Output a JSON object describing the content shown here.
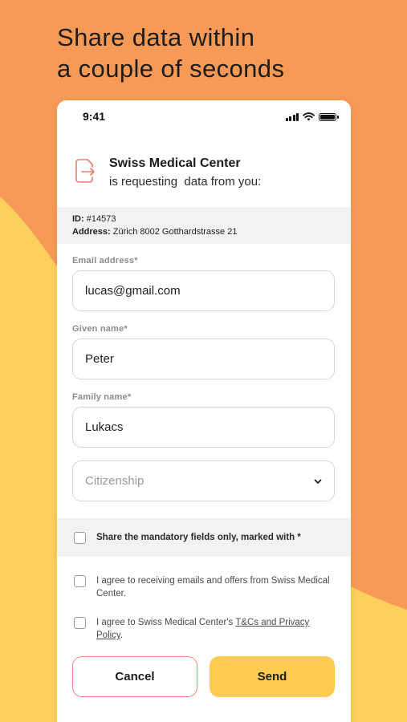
{
  "headline": {
    "line1": "Share data within",
    "line2": "a couple of seconds"
  },
  "colors": {
    "background_orange": "#F79A57",
    "background_yellow": "#FDCF5B",
    "accent_red": "#F08C7E",
    "send_yellow": "#FDCB52"
  },
  "status_bar": {
    "time": "9:41",
    "icons": [
      "signal-icon",
      "wifi-icon",
      "battery-icon"
    ]
  },
  "requester": {
    "icon": "document-export-icon",
    "name": "Swiss Medical Center",
    "message": "is requesting  data from you:"
  },
  "info": {
    "id_label": "ID:",
    "id_value": "#14573",
    "address_label": "Address:",
    "address_value": "Zürich 8002 Gotthardstrasse 21"
  },
  "form": {
    "email_label": "Email address*",
    "email_value": "lucas@gmail.com",
    "given_label": "Given name*",
    "given_value": "Peter",
    "family_label": "Family name*",
    "family_value": "Lukacs",
    "citizenship_placeholder": "Citizenship"
  },
  "options": {
    "mandatory_only": "Share the mandatory fields only, marked with *",
    "emails_consent": "I agree to receiving emails and offers from Swiss Medical Center.",
    "terms_prefix": "I agree to Swiss Medical Center's ",
    "terms_link": "T&Cs and Privacy Policy",
    "terms_suffix": "."
  },
  "buttons": {
    "cancel": "Cancel",
    "send": "Send"
  }
}
